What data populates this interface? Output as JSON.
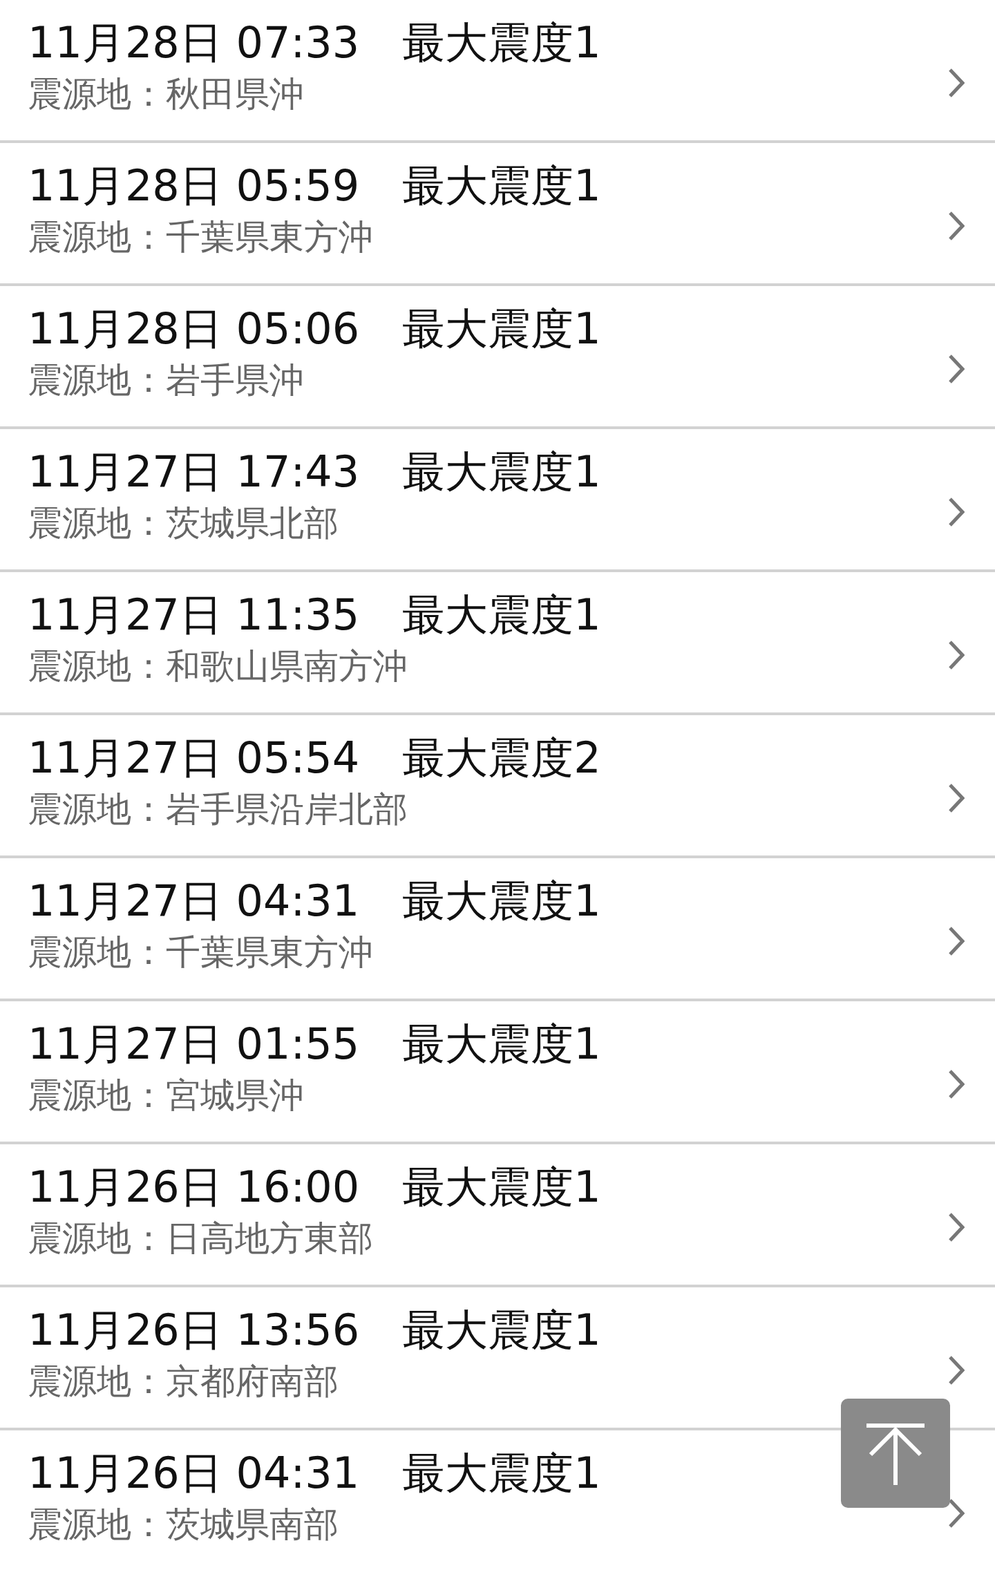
{
  "earthquakes": [
    {
      "title": "11月28日 07:33　最大震度1",
      "epicenter": "震源地：秋田県沖"
    },
    {
      "title": "11月28日 05:59　最大震度1",
      "epicenter": "震源地：千葉県東方沖"
    },
    {
      "title": "11月28日 05:06　最大震度1",
      "epicenter": "震源地：岩手県沖"
    },
    {
      "title": "11月27日 17:43　最大震度1",
      "epicenter": "震源地：茨城県北部"
    },
    {
      "title": "11月27日 11:35　最大震度1",
      "epicenter": "震源地：和歌山県南方沖"
    },
    {
      "title": "11月27日 05:54　最大震度2",
      "epicenter": "震源地：岩手県沿岸北部"
    },
    {
      "title": "11月27日 04:31　最大震度1",
      "epicenter": "震源地：千葉県東方沖"
    },
    {
      "title": "11月27日 01:55　最大震度1",
      "epicenter": "震源地：宮城県沖"
    },
    {
      "title": "11月26日 16:00　最大震度1",
      "epicenter": "震源地：日高地方東部"
    },
    {
      "title": "11月26日 13:56　最大震度1",
      "epicenter": "震源地：京都府南部"
    },
    {
      "title": "11月26日 04:31　最大震度1",
      "epicenter": "震源地：茨城県南部"
    }
  ]
}
